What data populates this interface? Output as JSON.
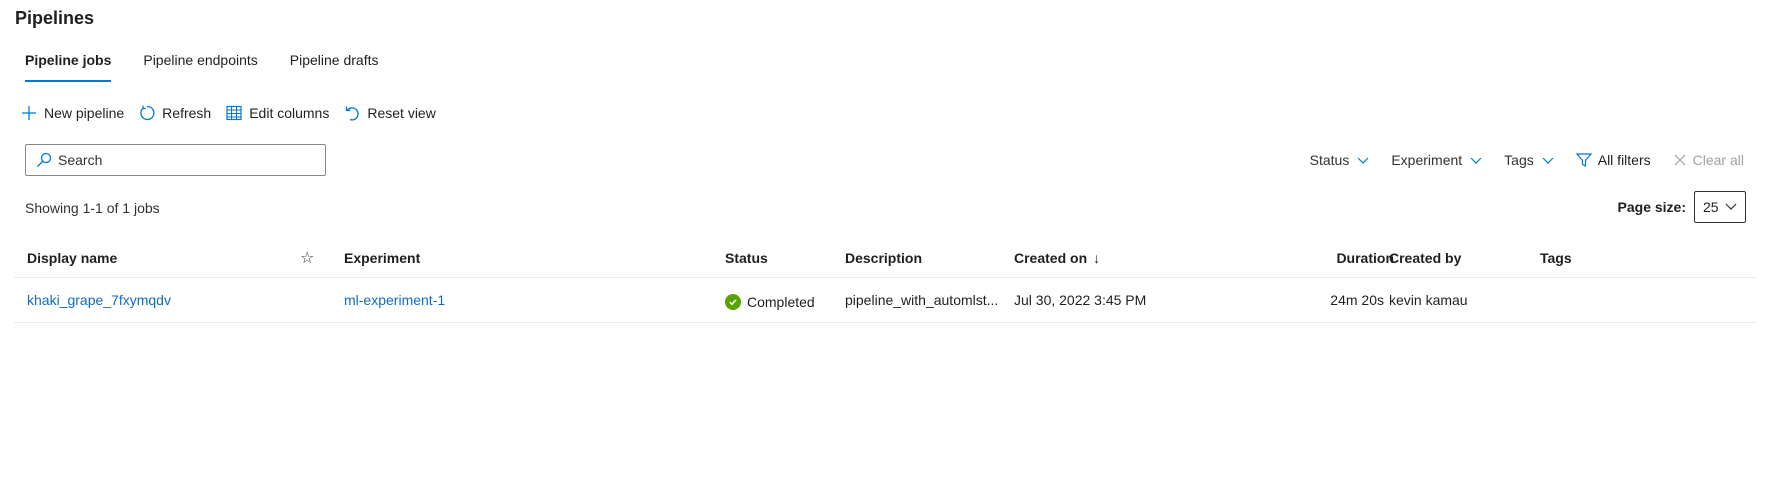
{
  "page": {
    "title": "Pipelines"
  },
  "tabs": [
    {
      "label": "Pipeline jobs",
      "active": true
    },
    {
      "label": "Pipeline endpoints",
      "active": false
    },
    {
      "label": "Pipeline drafts",
      "active": false
    }
  ],
  "toolbar": {
    "new_pipeline": "New pipeline",
    "refresh": "Refresh",
    "edit_columns": "Edit columns",
    "reset_view": "Reset view"
  },
  "search": {
    "placeholder": "Search",
    "value": ""
  },
  "filters": {
    "status": "Status",
    "experiment": "Experiment",
    "tags": "Tags",
    "all_filters": "All filters",
    "clear_all": "Clear all"
  },
  "summary": {
    "showing": "Showing 1-1 of 1 jobs"
  },
  "pagesize": {
    "label": "Page size:",
    "value": "25"
  },
  "grid": {
    "columns": {
      "display_name": "Display name",
      "experiment": "Experiment",
      "status": "Status",
      "description": "Description",
      "created_on": "Created on",
      "duration": "Duration",
      "created_by": "Created by",
      "tags": "Tags"
    },
    "sort_indicator": "↓",
    "rows": [
      {
        "display_name": "khaki_grape_7fxymqdv",
        "experiment": "ml-experiment-1",
        "status": "Completed",
        "description": "pipeline_with_automlst...",
        "created_on": "Jul 30, 2022 3:45 PM",
        "duration": "24m 20s",
        "created_by": "kevin kamau",
        "tags": ""
      }
    ]
  },
  "colors": {
    "accent": "#0078d4",
    "link": "#0f6cbd",
    "success": "#57a300",
    "border": "#edebe9"
  }
}
